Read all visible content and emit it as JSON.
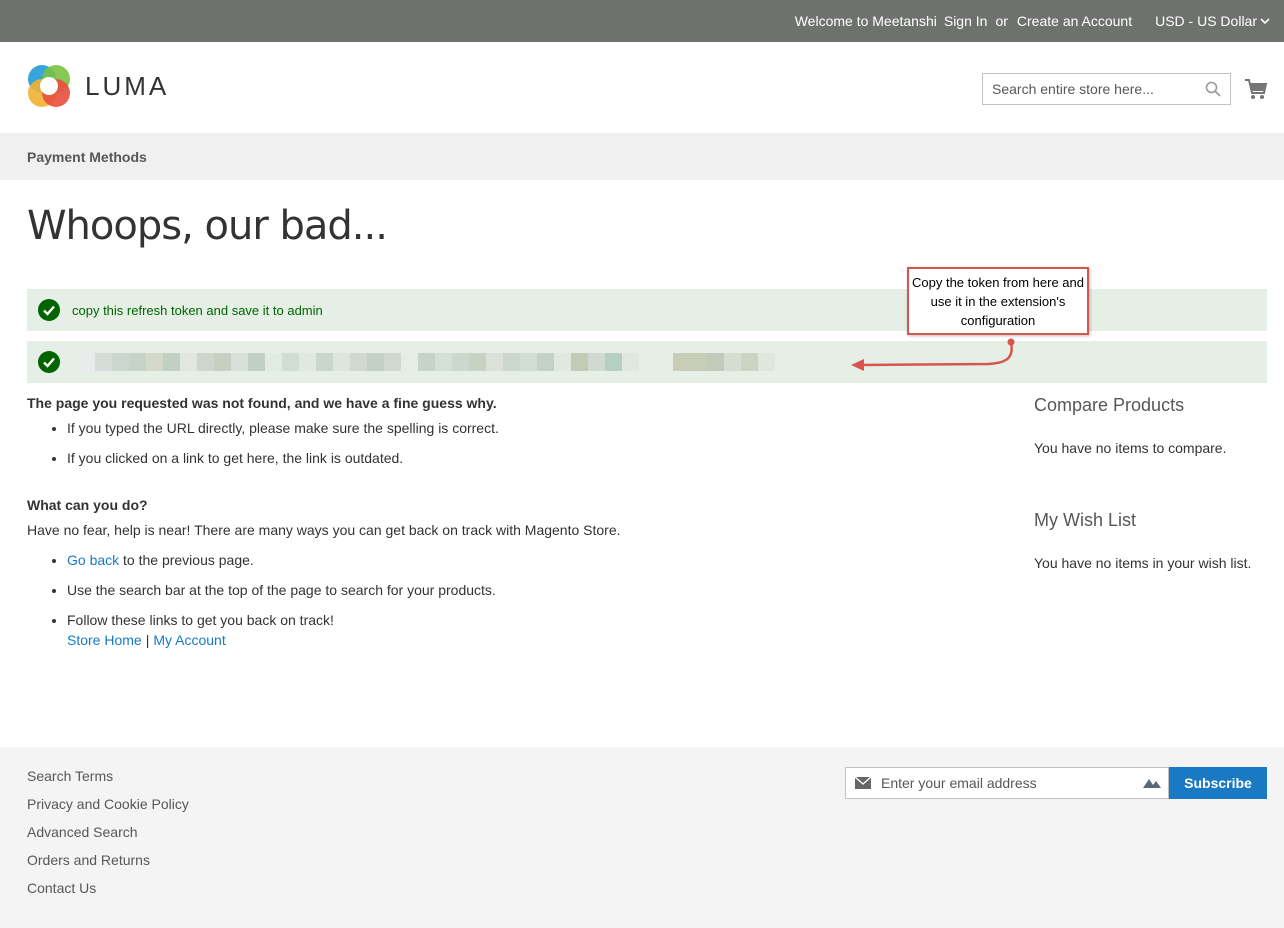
{
  "topbar": {
    "welcome": "Welcome to Meetanshi",
    "sign_in": "Sign In",
    "or": "or",
    "create_account": "Create an Account",
    "currency": "USD - US Dollar"
  },
  "header": {
    "logo_text": "LUMA",
    "search_placeholder": "Search entire store here...",
    "cart_icon": "cart-icon"
  },
  "nav": {
    "item": "Payment Methods"
  },
  "page": {
    "title": "Whoops, our bad...",
    "messages": [
      {
        "text": "copy this refresh token and save it to admin",
        "type": "success"
      },
      {
        "text": "",
        "type": "success",
        "blurred_token": true
      }
    ]
  },
  "annotation": {
    "callout": "Copy the token from here and use it in the extension's configuration",
    "color": "#d9534f"
  },
  "content": {
    "heading1": "The page you requested was not found, and we have a fine guess why.",
    "reasons": [
      "If you typed the URL directly, please make sure the spelling is correct.",
      "If you clicked on a link to get here, the link is outdated."
    ],
    "heading2": "What can you do?",
    "intro": "Have no fear, help is near! There are many ways you can get back on track with Magento Store.",
    "go_back_link": "Go back",
    "go_back_rest": " to the previous page.",
    "search_tip": "Use the search bar at the top of the page to search for your products.",
    "follow_links": "Follow these links to get you back on track!",
    "store_home": "Store Home",
    "separator": "|",
    "my_account": "My Account"
  },
  "sidebar": {
    "compare_title": "Compare Products",
    "compare_text": "You have no items to compare.",
    "wishlist_title": "My Wish List",
    "wishlist_text": "You have no items in your wish list."
  },
  "footer": {
    "links": [
      "Search Terms",
      "Privacy and Cookie Policy",
      "Advanced Search",
      "Orders and Returns",
      "Contact Us"
    ],
    "email_placeholder": "Enter your email address",
    "subscribe": "Subscribe"
  },
  "colors": {
    "topbar": "#6e716e",
    "link": "#1979c3",
    "success_bg": "#e5efe5",
    "success_icon": "#006400"
  }
}
